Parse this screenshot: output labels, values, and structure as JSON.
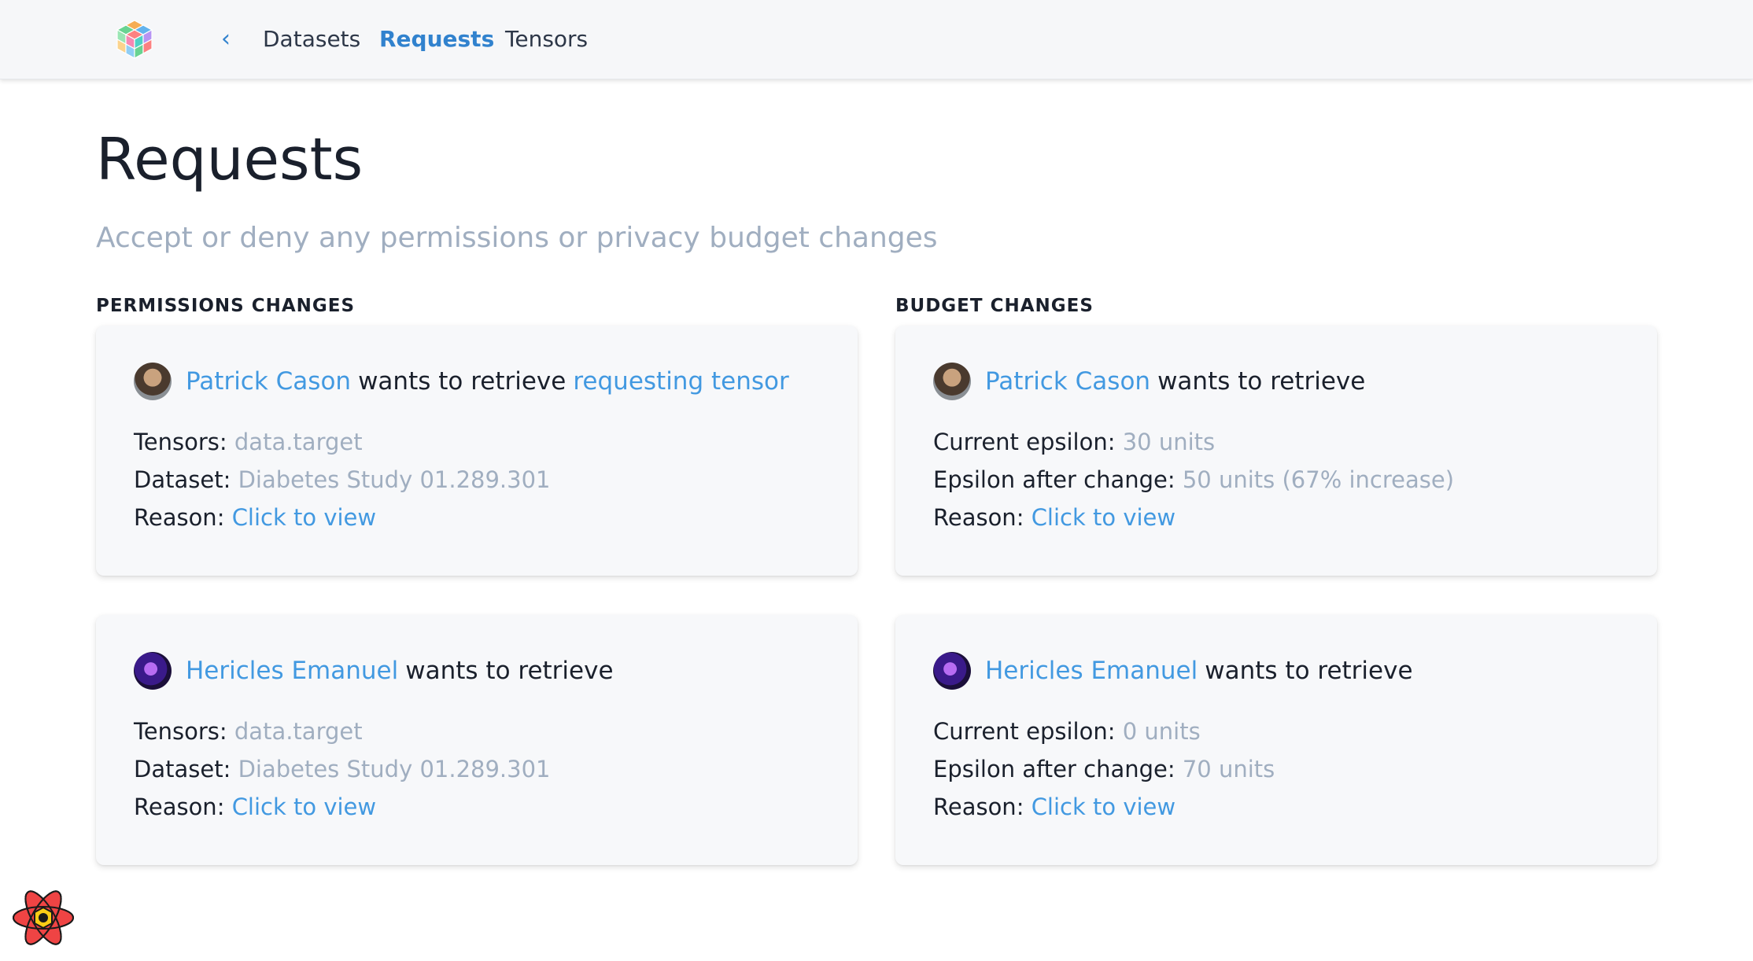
{
  "nav": {
    "items": [
      "Datasets",
      "Requests",
      "Tensors"
    ],
    "active": "Requests"
  },
  "page": {
    "title": "Requests",
    "subtitle": "Accept or deny any permissions or privacy budget changes"
  },
  "sections": {
    "permissions_heading": "PERMISSIONS CHANGES",
    "budget_heading": "BUDGET CHANGES"
  },
  "permissions": [
    {
      "user": "Patrick Cason",
      "action": "wants to retrieve",
      "object_link": "requesting tensor",
      "tensors_label": "Tensors:",
      "tensors_value": "data.target",
      "dataset_label": "Dataset:",
      "dataset_value": "Diabetes Study 01.289.301",
      "reason_label": "Reason:",
      "reason_link": "Click to view"
    },
    {
      "user": "Hericles Emanuel",
      "action": "wants to retrieve",
      "object_link": "",
      "tensors_label": "Tensors:",
      "tensors_value": "data.target",
      "dataset_label": "Dataset:",
      "dataset_value": "Diabetes Study 01.289.301",
      "reason_label": "Reason:",
      "reason_link": "Click to view"
    }
  ],
  "budgets": [
    {
      "user": "Patrick Cason",
      "action": "wants to retrieve",
      "current_label": "Current epsilon:",
      "current_value": "30 units",
      "after_label": "Epsilon after change:",
      "after_value": "50 units (67% increase)",
      "reason_label": "Reason:",
      "reason_link": "Click to view"
    },
    {
      "user": "Hericles Emanuel",
      "action": "wants to retrieve",
      "current_label": "Current epsilon:",
      "current_value": "0 units",
      "after_label": "Epsilon after change:",
      "after_value": "70 units",
      "reason_label": "Reason:",
      "reason_link": "Click to view"
    }
  ],
  "icons": {
    "logo": "cube-logo-icon",
    "back": "chevron-left-icon",
    "devtools": "react-devtools-icon"
  },
  "colors": {
    "accent": "#3182ce",
    "link": "#4299e1",
    "muted": "#a0aec0",
    "text": "#1a202c",
    "card_bg": "#f7f8fa",
    "nav_bg": "#f6f7f9"
  }
}
